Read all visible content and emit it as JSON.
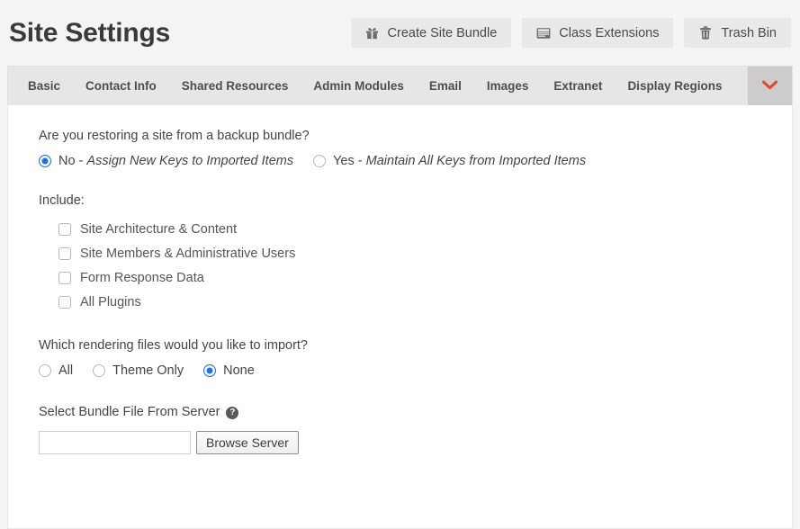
{
  "header": {
    "title": "Site Settings",
    "actions": [
      {
        "label": "Create Site Bundle",
        "icon": "gift-icon"
      },
      {
        "label": "Class Extensions",
        "icon": "window-icon"
      },
      {
        "label": "Trash Bin",
        "icon": "trash-icon"
      }
    ]
  },
  "tabs": {
    "items": [
      {
        "label": "Basic"
      },
      {
        "label": "Contact Info"
      },
      {
        "label": "Shared Resources"
      },
      {
        "label": "Admin Modules"
      },
      {
        "label": "Email"
      },
      {
        "label": "Images"
      },
      {
        "label": "Extranet"
      },
      {
        "label": "Display Regions"
      }
    ],
    "more_icon": "chevron-down-icon",
    "more_icon_color": "#e8452c"
  },
  "form": {
    "restore_question": "Are you restoring a site from a backup bundle?",
    "restore_options": [
      {
        "prefix": "No - ",
        "detail": "Assign New Keys to Imported Items",
        "selected": true
      },
      {
        "prefix": "Yes - ",
        "detail": "Maintain All Keys from Imported Items",
        "selected": false
      }
    ],
    "include_label": "Include:",
    "include_options": [
      {
        "label": "Site Architecture & Content",
        "checked": false
      },
      {
        "label": "Site Members & Administrative Users",
        "checked": false
      },
      {
        "label": "Form Response Data",
        "checked": false
      },
      {
        "label": "All Plugins",
        "checked": false
      }
    ],
    "rendering_question": "Which rendering files would you like to import?",
    "rendering_options": [
      {
        "label": "All",
        "selected": false
      },
      {
        "label": "Theme Only",
        "selected": false
      },
      {
        "label": "None",
        "selected": true
      }
    ],
    "bundle_label": "Select Bundle File From Server",
    "bundle_help_icon": "help-icon",
    "bundle_input_value": "",
    "bundle_input_placeholder": "",
    "browse_button": "Browse Server"
  },
  "colors": {
    "accent_red": "#e8452c",
    "radio_blue": "#1a73e8",
    "page_bg": "#f4f4f4"
  }
}
